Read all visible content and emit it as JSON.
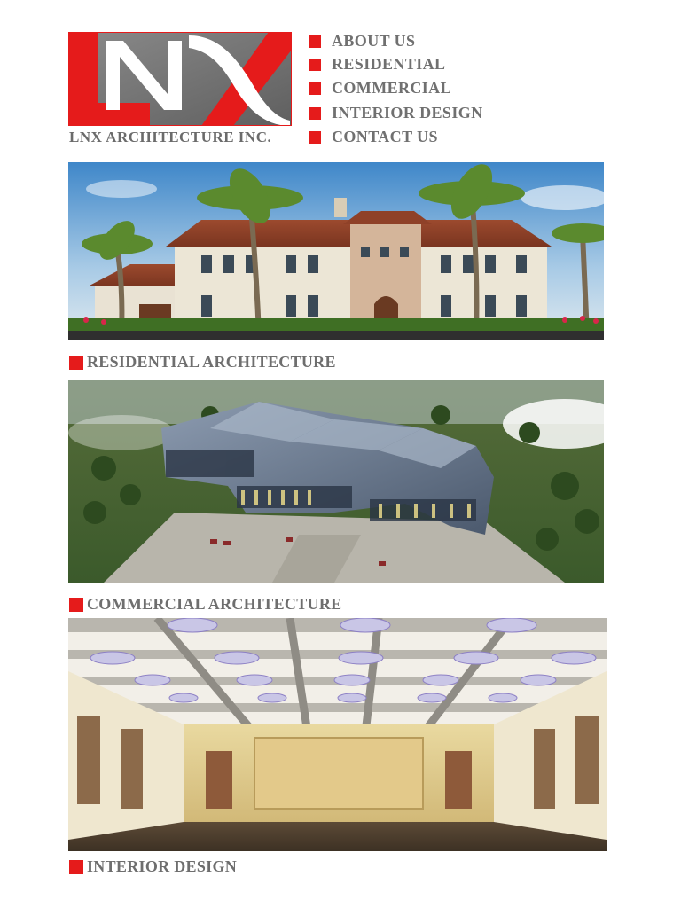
{
  "brand": {
    "logo_letters": "LNX",
    "company_name": "LNX ARCHITECTURE INC.",
    "colors": {
      "red": "#e51b1b",
      "gray": "#7a7a7a"
    }
  },
  "nav": {
    "items": [
      {
        "label": "ABOUT US"
      },
      {
        "label": "RESIDENTIAL"
      },
      {
        "label": "COMMERCIAL"
      },
      {
        "label": "INTERIOR DESIGN"
      },
      {
        "label": "CONTACT US"
      }
    ]
  },
  "sections": [
    {
      "caption": "RESIDENTIAL ARCHITECTURE"
    },
    {
      "caption": "COMMERCIAL ARCHITECTURE"
    },
    {
      "caption": "INTERIOR DESIGN"
    }
  ]
}
